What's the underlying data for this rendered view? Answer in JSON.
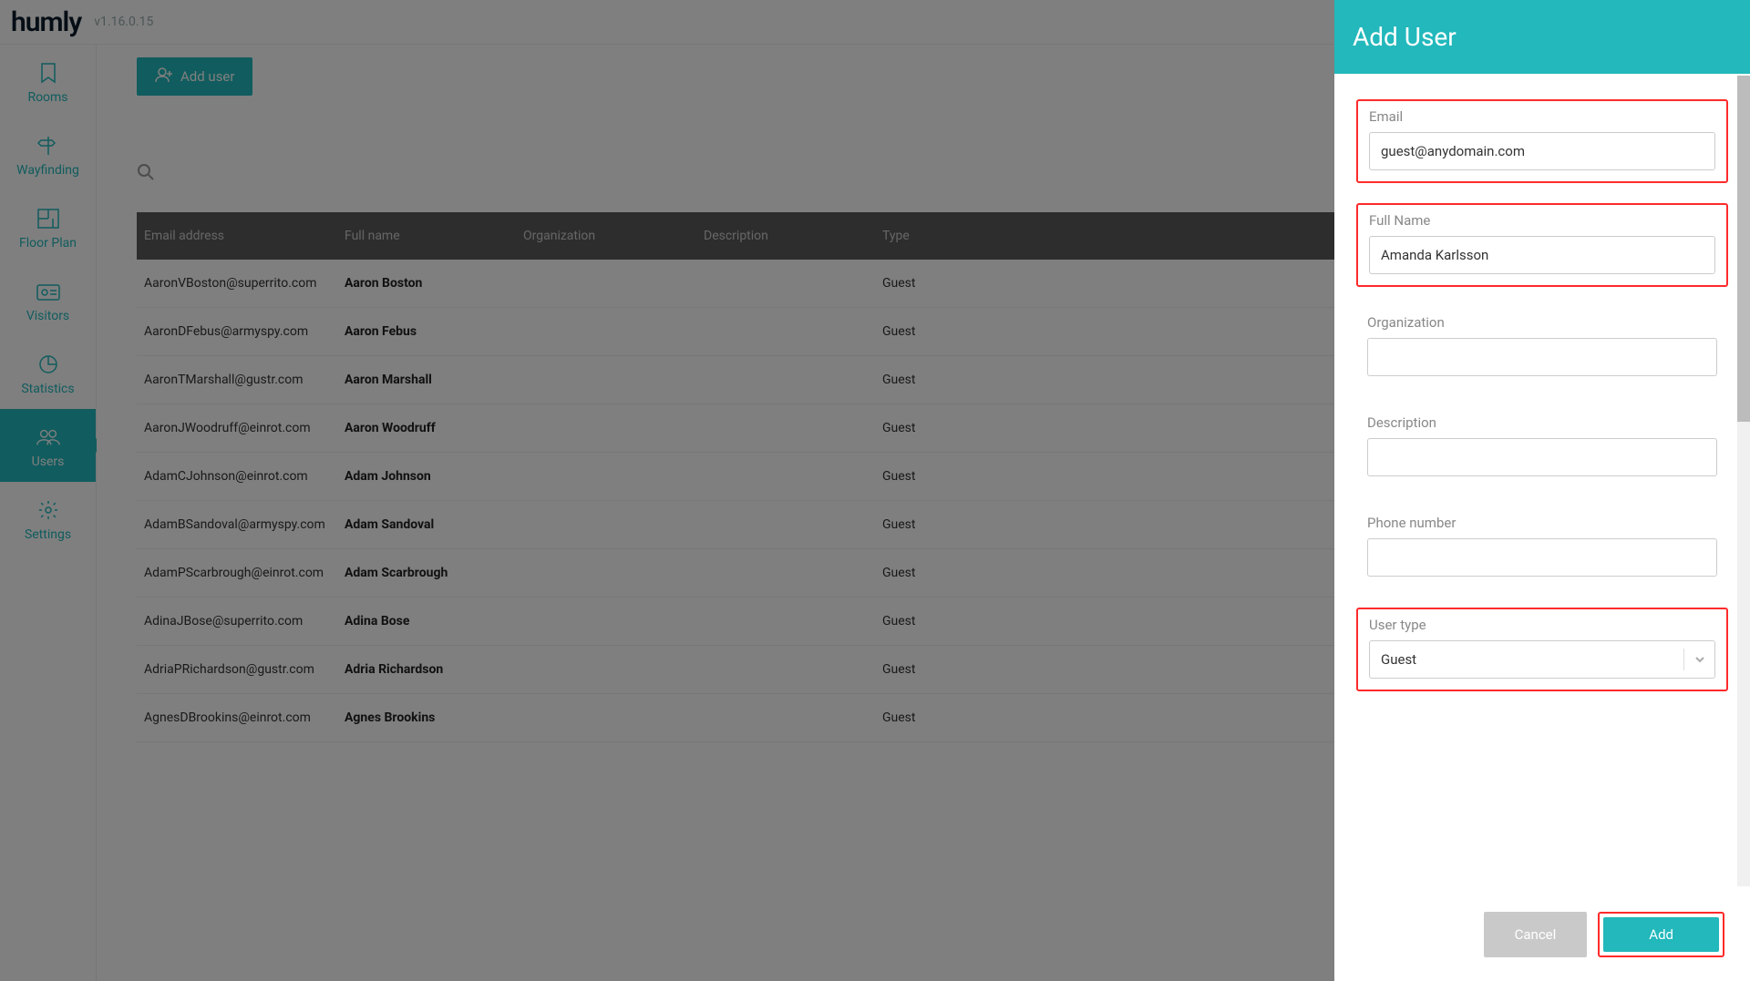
{
  "header": {
    "logo": "humly",
    "version": "v1.16.0.15"
  },
  "sidebar": {
    "items": [
      {
        "label": "Rooms"
      },
      {
        "label": "Wayfinding"
      },
      {
        "label": "Floor Plan"
      },
      {
        "label": "Visitors"
      },
      {
        "label": "Statistics"
      },
      {
        "label": "Users"
      },
      {
        "label": "Settings"
      }
    ]
  },
  "main": {
    "add_user_label": "Add user",
    "columns": {
      "email": "Email address",
      "name": "Full name",
      "org": "Organization",
      "desc": "Description",
      "type": "Type"
    },
    "rows": [
      {
        "email": "AaronVBoston@superrito.com",
        "name": "Aaron Boston",
        "type": "Guest"
      },
      {
        "email": "AaronDFebus@armyspy.com",
        "name": "Aaron Febus",
        "type": "Guest"
      },
      {
        "email": "AaronTMarshall@gustr.com",
        "name": "Aaron Marshall",
        "type": "Guest"
      },
      {
        "email": "AaronJWoodruff@einrot.com",
        "name": "Aaron Woodruff",
        "type": "Guest"
      },
      {
        "email": "AdamCJohnson@einrot.com",
        "name": "Adam Johnson",
        "type": "Guest"
      },
      {
        "email": "AdamBSandoval@armyspy.com",
        "name": "Adam Sandoval",
        "type": "Guest"
      },
      {
        "email": "AdamPScarbrough@einrot.com",
        "name": "Adam Scarbrough",
        "type": "Guest"
      },
      {
        "email": "AdinaJBose@superrito.com",
        "name": "Adina Bose",
        "type": "Guest"
      },
      {
        "email": "AdriaPRichardson@gustr.com",
        "name": "Adria Richardson",
        "type": "Guest"
      },
      {
        "email": "AgnesDBrookins@einrot.com",
        "name": "Agnes Brookins",
        "type": "Guest"
      }
    ]
  },
  "drawer": {
    "title": "Add User",
    "fields": {
      "email_label": "Email",
      "email_value": "guest@anydomain.com",
      "name_label": "Full Name",
      "name_value": "Amanda Karlsson",
      "org_label": "Organization",
      "org_value": "",
      "desc_label": "Description",
      "desc_value": "",
      "phone_label": "Phone number",
      "phone_value": "",
      "type_label": "User type",
      "type_value": "Guest"
    },
    "cancel_label": "Cancel",
    "add_label": "Add"
  }
}
